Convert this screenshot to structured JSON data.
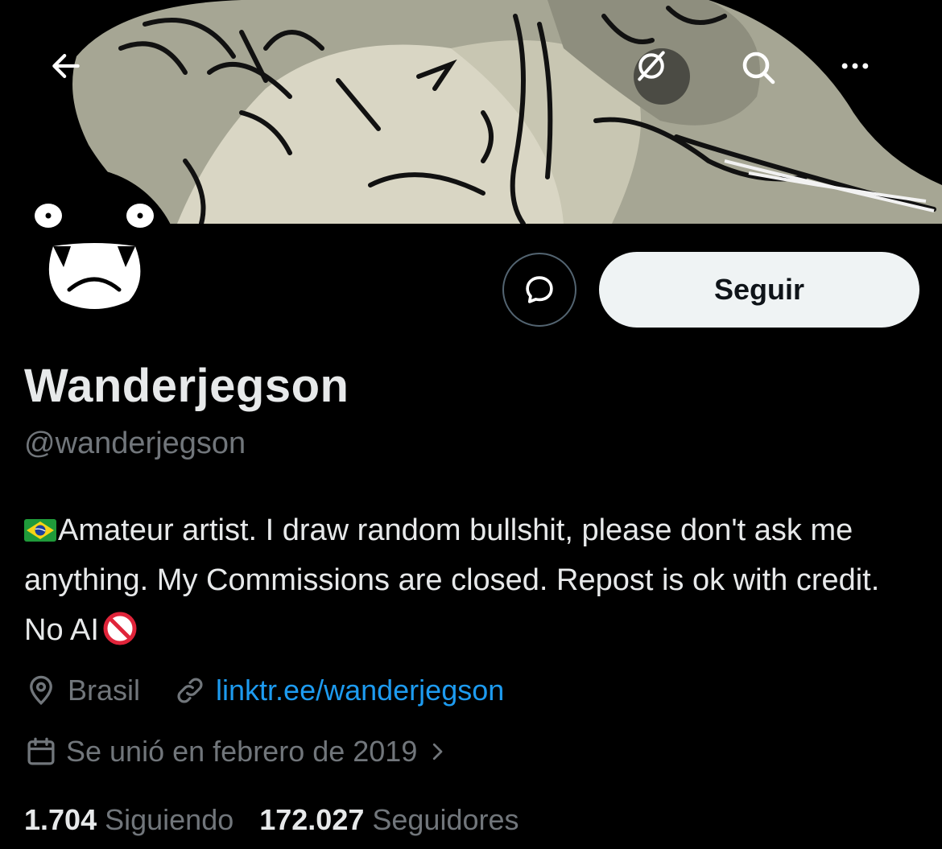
{
  "header": {
    "back_icon": "arrow-left-icon",
    "translate_icon": "globe-slash-icon",
    "search_icon": "search-icon",
    "more_icon": "more-horizontal-icon"
  },
  "profile": {
    "display_name": "Wanderjegson",
    "handle": "@wanderjegson",
    "bio_text": "Amateur artist. I draw random bullshit, please don't ask me anything. My Commissions are closed. Repost is ok with credit. No AI",
    "bio_flag_icon": "brazil-flag-icon",
    "bio_end_icon": "no-entry-icon",
    "location": "Brasil",
    "website": "linktr.ee/wanderjegson",
    "joined": "Se unió en febrero de 2019",
    "following_count": "1.704",
    "following_label": "Siguiendo",
    "followers_count": "172.027",
    "followers_label": "Seguidores"
  },
  "actions": {
    "message_icon": "message-bubble-icon",
    "follow_label": "Seguir"
  },
  "colors": {
    "background": "#000000",
    "text_primary": "#e7e9ea",
    "text_secondary": "#71767b",
    "link": "#1d9bf0",
    "follow_button_bg": "#eff3f4"
  }
}
